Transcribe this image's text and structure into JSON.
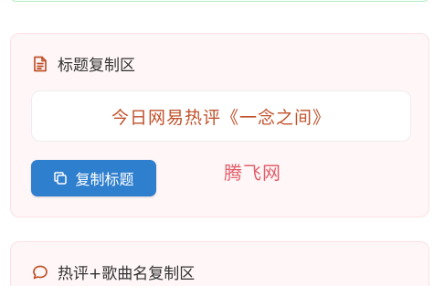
{
  "title_section": {
    "heading": "标题复制区",
    "icon": "document-icon",
    "title_text": "今日网易热评《一念之间》",
    "copy_button_label": "复制标题",
    "copy_icon": "copy-icon",
    "watermark": "腾飞网"
  },
  "comment_section": {
    "heading": "热评+歌曲名复制区",
    "icon": "comment-icon"
  },
  "colors": {
    "accent_icon": "#c0522b",
    "button": "#2f7fcf",
    "title_text": "#c0522b",
    "watermark": "#e0606b",
    "card_bg": "#fff6f7"
  }
}
